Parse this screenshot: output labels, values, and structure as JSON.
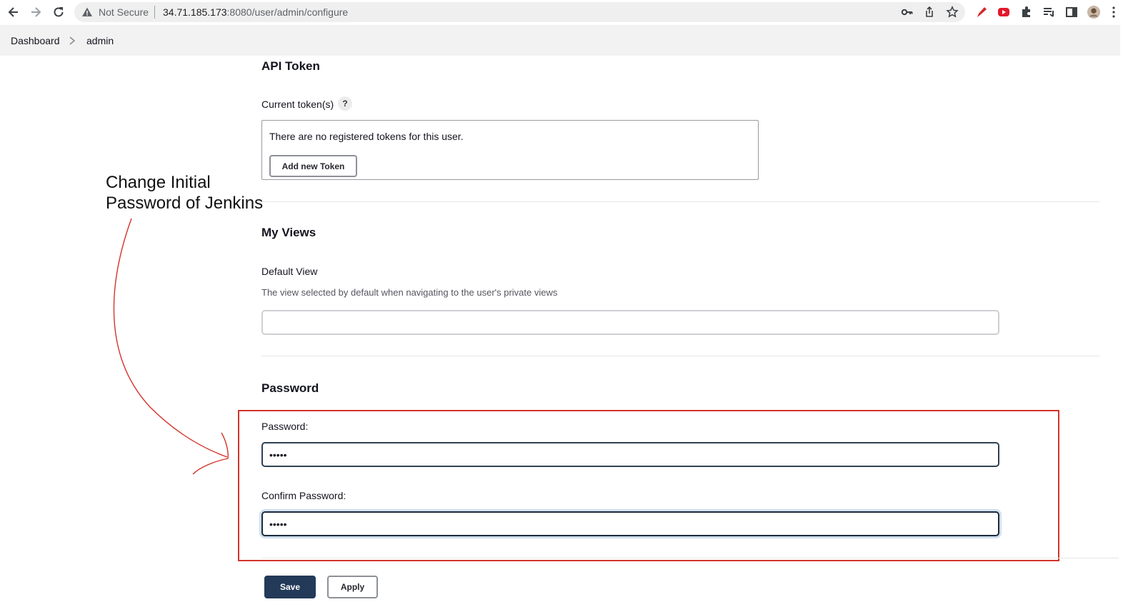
{
  "browser": {
    "security_label": "Not Secure",
    "url_host": "34.71.185.173",
    "url_rest": ":8080/user/admin/configure"
  },
  "breadcrumb": {
    "items": [
      "Dashboard",
      "admin"
    ]
  },
  "api_token": {
    "title": "API Token",
    "current_label": "Current token(s)",
    "help": "?",
    "empty_message": "There are no registered tokens for this user.",
    "add_button": "Add new Token"
  },
  "my_views": {
    "title": "My Views",
    "default_view_label": "Default View",
    "default_view_description": "The view selected by default when navigating to the user's private views",
    "default_view_value": ""
  },
  "password": {
    "title": "Password",
    "password_label": "Password:",
    "password_value": "•••••",
    "confirm_label": "Confirm Password:",
    "confirm_value": "•••••"
  },
  "annotation": {
    "line1": "Change Initial",
    "line2": "Password of Jenkins",
    "color": "#d3332a"
  },
  "actions": {
    "save": "Save",
    "apply": "Apply"
  },
  "colors": {
    "primary": "#233a58",
    "annotation_red": "#d3332a"
  }
}
